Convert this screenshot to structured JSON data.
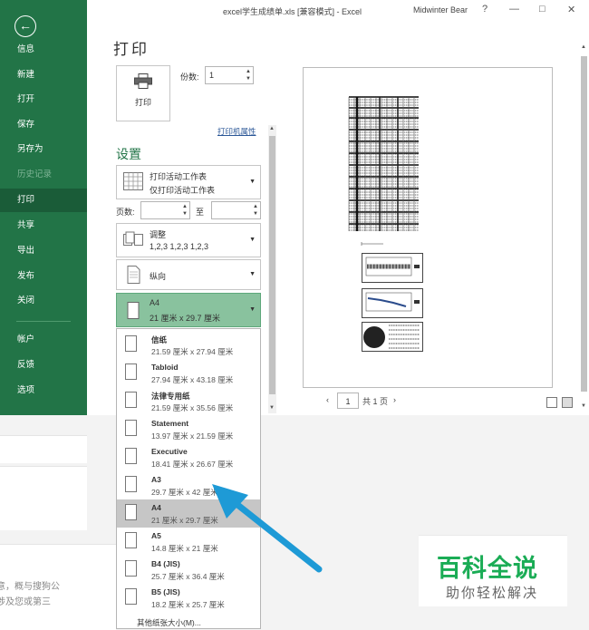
{
  "window": {
    "title": "excel学生成绩单.xls  [兼容模式]  -  Excel",
    "user": "Midwinter Bear",
    "help": "?",
    "controls": [
      "—",
      "□",
      "✕"
    ]
  },
  "sidebar": {
    "back_icon": "back-arrow-icon",
    "items": [
      {
        "label": "信息",
        "state": "normal"
      },
      {
        "label": "新建",
        "state": "normal"
      },
      {
        "label": "打开",
        "state": "normal"
      },
      {
        "label": "保存",
        "state": "normal"
      },
      {
        "label": "另存为",
        "state": "normal"
      },
      {
        "label": "历史记录",
        "state": "disabled"
      },
      {
        "label": "打印",
        "state": "active"
      },
      {
        "label": "共享",
        "state": "normal"
      },
      {
        "label": "导出",
        "state": "normal"
      },
      {
        "label": "发布",
        "state": "normal"
      },
      {
        "label": "关闭",
        "state": "normal"
      },
      {
        "label": "帐户",
        "state": "normal"
      },
      {
        "label": "反馈",
        "state": "normal"
      },
      {
        "label": "选项",
        "state": "normal"
      }
    ]
  },
  "print": {
    "heading": "打印",
    "button_label": "打印",
    "copies_label": "份数:",
    "copies_value": "1",
    "printer_properties": "打印机属性",
    "settings_heading": "设置",
    "what": {
      "line1": "打印活动工作表",
      "line2": "仅打印活动工作表"
    },
    "pages_label": "页数:",
    "pages_to": "至",
    "collate": {
      "line1": "调整",
      "line2": "1,2,3    1,2,3    1,2,3"
    },
    "orientation": "纵向",
    "paper": {
      "line1": "A4",
      "line2": "21 厘米 x 29.7 厘米"
    }
  },
  "paper_sizes": [
    {
      "name": "信纸",
      "dims": "21.59 厘米 x 27.94 厘米",
      "selected": false
    },
    {
      "name": "Tabloid",
      "dims": "27.94 厘米 x 43.18 厘米",
      "selected": false
    },
    {
      "name": "法律专用纸",
      "dims": "21.59 厘米 x 35.56 厘米",
      "selected": false
    },
    {
      "name": "Statement",
      "dims": "13.97 厘米 x 21.59 厘米",
      "selected": false
    },
    {
      "name": "Executive",
      "dims": "18.41 厘米 x 26.67 厘米",
      "selected": false
    },
    {
      "name": "A3",
      "dims": "29.7 厘米 x 42 厘米",
      "selected": false
    },
    {
      "name": "A4",
      "dims": "21 厘米 x 29.7 厘米",
      "selected": true
    },
    {
      "name": "A5",
      "dims": "14.8 厘米 x 21 厘米",
      "selected": false
    },
    {
      "name": "B4 (JIS)",
      "dims": "25.7 厘米 x 36.4 厘米",
      "selected": false
    },
    {
      "name": "B5 (JIS)",
      "dims": "18.2 厘米 x 25.7 厘米",
      "selected": false
    }
  ],
  "more_sizes": "其他纸张大小(M)...",
  "preview": {
    "page_value": "1",
    "page_total": "共 1 页",
    "prev_icon": "chevron-left-icon",
    "next_icon": "chevron-right-icon"
  },
  "background": {
    "line1": "意，概与搜狗公",
    "line2": "涉及您或第三"
  },
  "watermark": {
    "title": "百科全说",
    "subtitle": "助你轻松解决"
  },
  "colors": {
    "excel_green": "#227447",
    "arrow_blue": "#1e9ad6",
    "watermark_green": "#1aac55"
  }
}
